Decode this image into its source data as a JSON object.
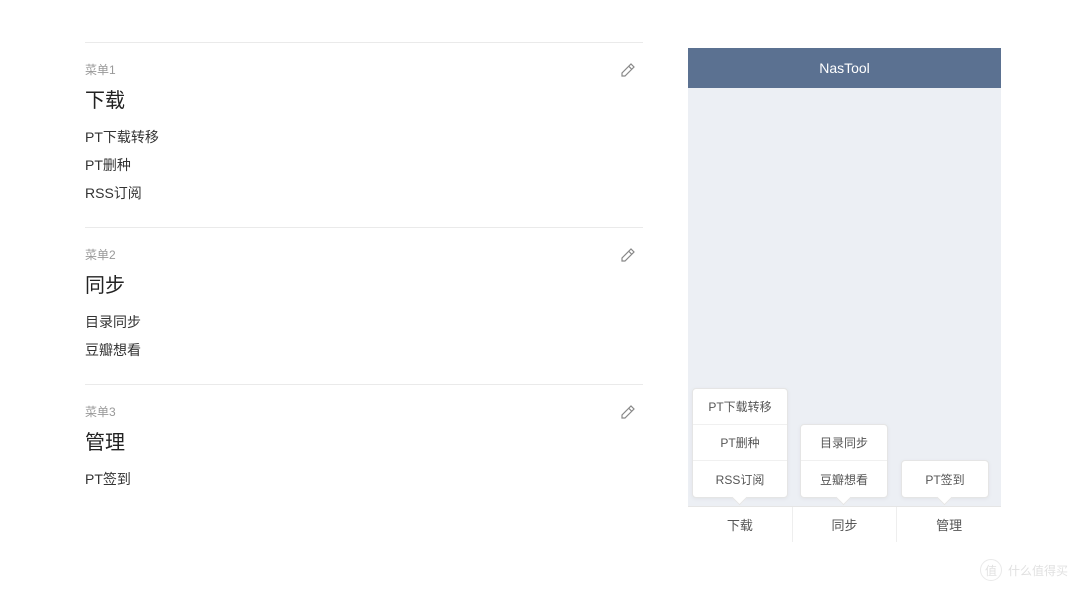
{
  "menus": [
    {
      "label": "菜单1",
      "title": "下载",
      "items": [
        "PT下载转移",
        "PT删种",
        "RSS订阅"
      ]
    },
    {
      "label": "菜单2",
      "title": "同步",
      "items": [
        "目录同步",
        "豆瓣想看"
      ]
    },
    {
      "label": "菜单3",
      "title": "管理",
      "items": [
        "PT签到"
      ]
    }
  ],
  "preview": {
    "header": "NasTool",
    "tabs": [
      "下载",
      "同步",
      "管理"
    ],
    "popups": [
      [
        "PT下载转移",
        "PT删种",
        "RSS订阅"
      ],
      [
        "目录同步",
        "豆瓣想看"
      ],
      [
        "PT签到"
      ]
    ]
  },
  "watermark": {
    "badge": "值",
    "text": "什么值得买"
  }
}
